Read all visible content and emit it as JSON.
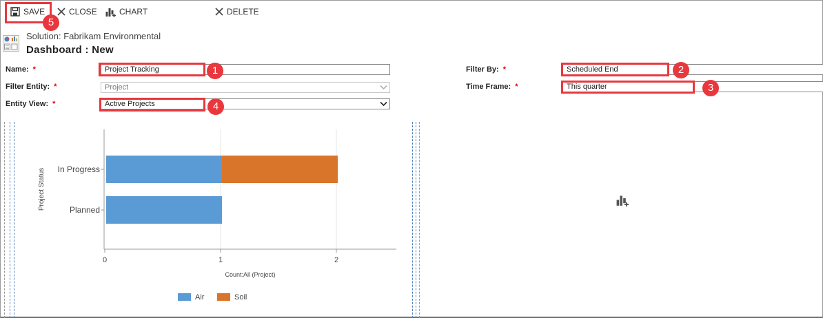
{
  "toolbar": {
    "save_label": "SAVE",
    "close_label": "CLOSE",
    "chart_label": "CHART",
    "delete_label": "DELETE"
  },
  "header": {
    "solution": "Solution: Fabrikam Environmental",
    "title": "Dashboard : New"
  },
  "form": {
    "name_label": "Name:",
    "name_value": "Project Tracking",
    "filter_entity_label": "Filter Entity:",
    "filter_entity_value": "Project",
    "entity_view_label": "Entity View:",
    "entity_view_value": "Active Projects",
    "filter_by_label": "Filter By:",
    "filter_by_value": "Scheduled End",
    "time_frame_label": "Time Frame:",
    "time_frame_value": "This quarter",
    "required_mark": "*"
  },
  "callouts": [
    "1",
    "2",
    "3",
    "4",
    "5"
  ],
  "colors": {
    "highlight": "#e8373d",
    "air": "#5b9bd5",
    "soil": "#d9752a"
  },
  "chart_data": {
    "type": "bar",
    "orientation": "horizontal",
    "stacked": true,
    "categories": [
      "In Progress",
      "Planned"
    ],
    "series": [
      {
        "name": "Air",
        "values": [
          1,
          1
        ],
        "color": "#5b9bd5"
      },
      {
        "name": "Soil",
        "values": [
          1,
          0
        ],
        "color": "#d9752a"
      }
    ],
    "x_ticks": [
      "0",
      "1",
      "2"
    ],
    "xlabel": "Count:All (Project)",
    "ylabel": "Project Status",
    "xlim": [
      0,
      2.5
    ],
    "grid": true,
    "legend": "bottom"
  }
}
